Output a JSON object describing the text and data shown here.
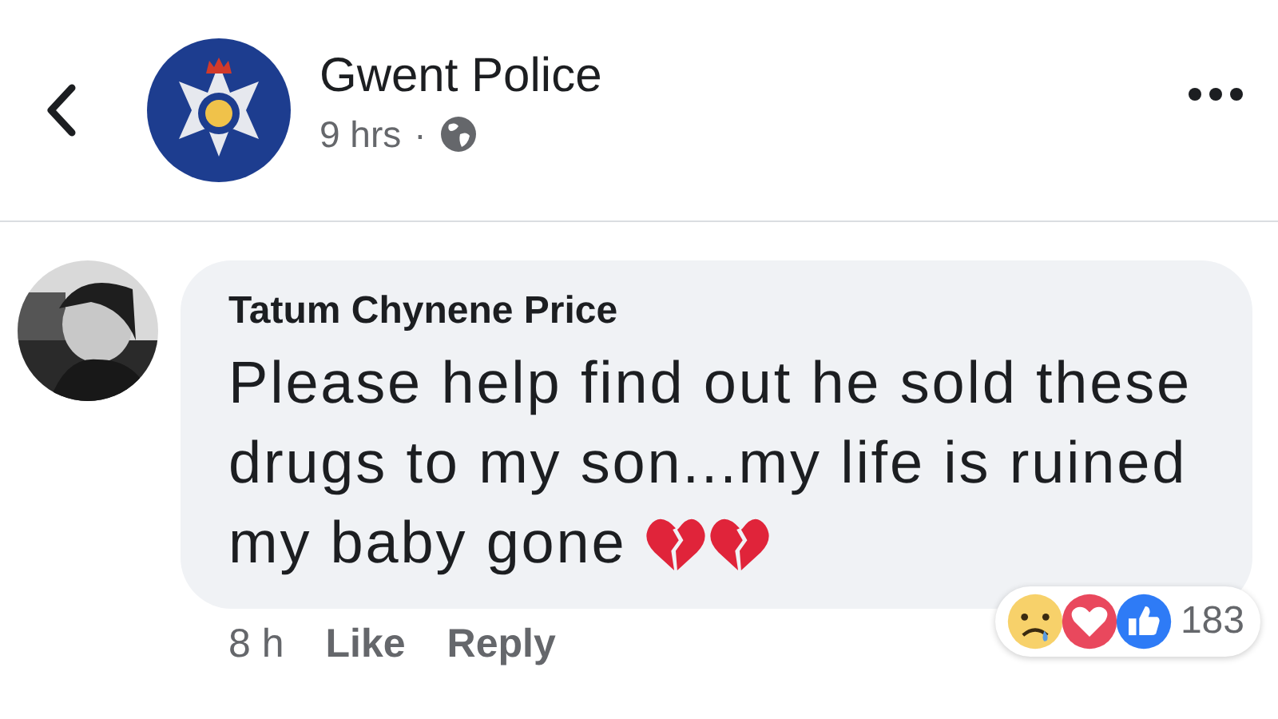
{
  "post": {
    "page_name": "Gwent Police",
    "time": "9 hrs",
    "separator": "·"
  },
  "comment": {
    "author": "Tatum Chynene Price",
    "text": "Please help find out he sold these drugs to my son...my life is ruined my baby gone",
    "emojis": [
      {
        "kind": "broken-heart"
      },
      {
        "kind": "broken-heart"
      }
    ],
    "time": "8 h",
    "actions": [
      "Like",
      "Reply"
    ],
    "reactions": [
      {
        "kind": "sad"
      },
      {
        "kind": "love"
      },
      {
        "kind": "like"
      }
    ],
    "reaction_count": "183"
  }
}
